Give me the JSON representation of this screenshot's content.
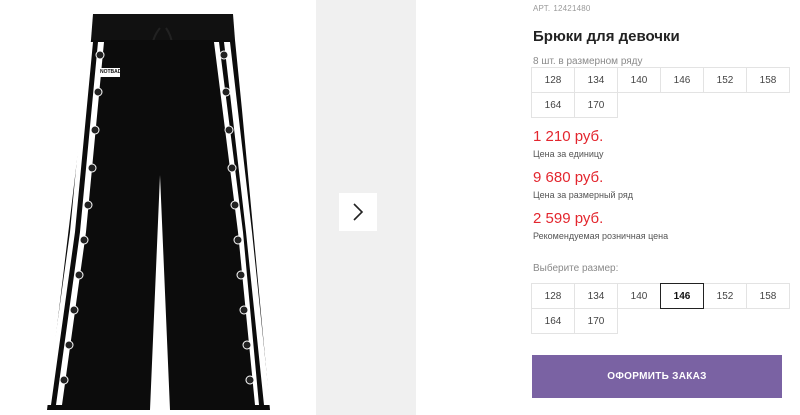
{
  "product": {
    "sku_prefix": "АРТ.",
    "sku": "12421480",
    "title": "Брюки для девочки",
    "image_alt": "Черные брюки с белыми лампасами и кнопками",
    "brand_tag": "NOTBAD"
  },
  "size_row": {
    "note": "8 шт. в размерном ряду",
    "sizes": [
      "128",
      "134",
      "140",
      "146",
      "152",
      "158",
      "164",
      "170"
    ]
  },
  "prices": [
    {
      "value": "1 210 руб.",
      "label": "Цена за единицу"
    },
    {
      "value": "9 680 руб.",
      "label": "Цена за размерный ряд"
    },
    {
      "value": "2 599 руб.",
      "label": "Рекомендуемая розничная цена"
    }
  ],
  "size_select": {
    "label": "Выберите размер:",
    "sizes": [
      "128",
      "134",
      "140",
      "146",
      "152",
      "158",
      "164",
      "170"
    ],
    "selected": "146"
  },
  "order_button": {
    "label": "ОФОРМИТЬ ЗАКАЗ"
  },
  "icons": {
    "next": "chevron-right-icon"
  },
  "colors": {
    "price": "#e3262e",
    "button": "#7a62a3",
    "thumb_bg": "#f0f0f0"
  }
}
